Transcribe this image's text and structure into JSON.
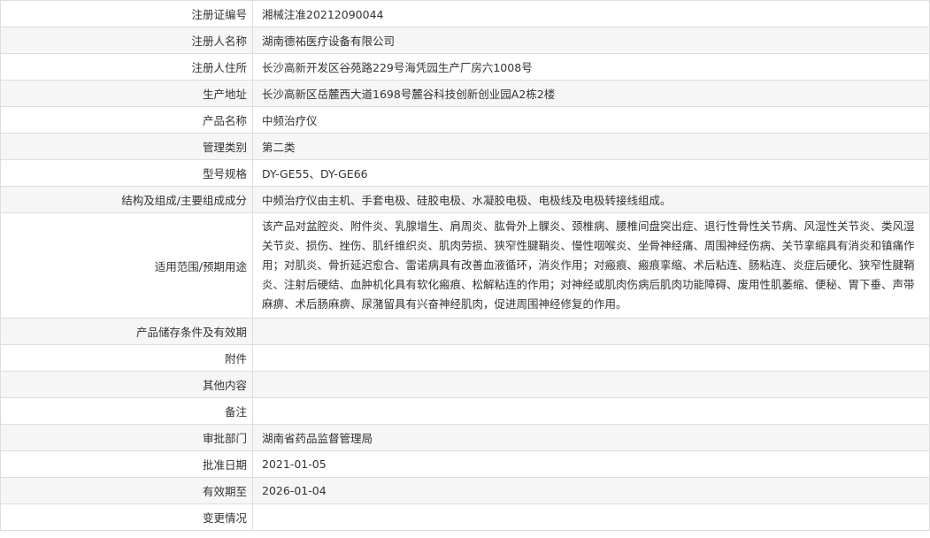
{
  "rows": [
    {
      "label": "注册证编号",
      "value": "湘械注准20212090044"
    },
    {
      "label": "注册人名称",
      "value": "湖南德祐医疗设备有限公司"
    },
    {
      "label": "注册人住所",
      "value": "长沙高新开发区谷苑路229号海凭园生产厂房六1008号"
    },
    {
      "label": "生产地址",
      "value": "长沙高新区岳麓西大道1698号麓谷科技创新创业园A2栋2楼"
    },
    {
      "label": "产品名称",
      "value": "中频治疗仪"
    },
    {
      "label": "管理类别",
      "value": "第二类"
    },
    {
      "label": "型号规格",
      "value": "DY-GE55、DY-GE66"
    },
    {
      "label": "结构及组成/主要组成成分",
      "value": "中频治疗仪由主机、手套电极、硅胶电极、水凝胶电极、电极线及电极转接线组成。"
    },
    {
      "label": "适用范围/预期用途",
      "value": "该产品对盆腔炎、附件炎、乳腺增生、肩周炎、肱骨外上髁炎、颈椎病、腰椎间盘突出症、退行性骨性关节病、风湿性关节炎、类风湿关节炎、损伤、挫伤、肌纤维织炎、肌肉劳损、狭窄性腱鞘炎、慢性咽喉炎、坐骨神经痛、周围神经伤病、关节挛缩具有消炎和镇痛作用；对肌炎、骨折延迟愈合、雷诺病具有改善血液循环，消炎作用；对瘢痕、瘢痕挛缩、术后粘连、肠粘连、炎症后硬化、狭窄性腱鞘炎、注射后硬结、血肿机化具有软化瘢痕、松解粘连的作用；对神经或肌肉伤病后肌肉功能障碍、废用性肌萎缩、便秘、胃下垂、声带麻痹、术后肠麻痹、尿潴留具有兴奋神经肌肉，促进周围神经修复的作用。"
    },
    {
      "label": "产品储存条件及有效期",
      "value": ""
    },
    {
      "label": "附件",
      "value": ""
    },
    {
      "label": "其他内容",
      "value": ""
    },
    {
      "label": "备注",
      "value": ""
    },
    {
      "label": "审批部门",
      "value": "湖南省药品监督管理局"
    },
    {
      "label": "批准日期",
      "value": "2021-01-05"
    },
    {
      "label": "有效期至",
      "value": "2026-01-04"
    },
    {
      "label": "变更情况",
      "value": ""
    }
  ]
}
